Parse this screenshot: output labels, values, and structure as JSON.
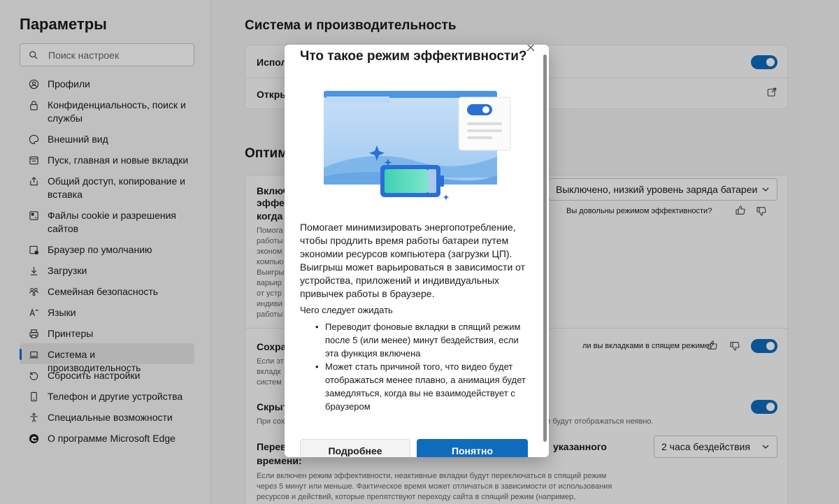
{
  "sidebar": {
    "title": "Параметры",
    "search_placeholder": "Поиск настроек",
    "items": [
      {
        "label": "Профили",
        "icon": "profile-icon"
      },
      {
        "label": "Конфиденциальность, поиск и службы",
        "icon": "lock-icon"
      },
      {
        "label": "Внешний вид",
        "icon": "palette-icon"
      },
      {
        "label": "Пуск, главная и новые вкладки",
        "icon": "home-tab-icon"
      },
      {
        "label": "Общий доступ, копирование и вставка",
        "icon": "share-icon"
      },
      {
        "label": "Файлы cookie и разрешения сайтов",
        "icon": "cookie-icon"
      },
      {
        "label": "Браузер по умолчанию",
        "icon": "default-browser-icon"
      },
      {
        "label": "Загрузки",
        "icon": "download-icon"
      },
      {
        "label": "Семейная безопасность",
        "icon": "family-icon"
      },
      {
        "label": "Языки",
        "icon": "language-icon"
      },
      {
        "label": "Принтеры",
        "icon": "printer-icon"
      },
      {
        "label": "Система и производительность",
        "icon": "laptop-icon",
        "active": true
      },
      {
        "label": "Сбросить настройки",
        "icon": "reset-icon"
      },
      {
        "label": "Телефон и другие устройства",
        "icon": "phone-icon"
      },
      {
        "label": "Специальные возможности",
        "icon": "accessibility-icon"
      },
      {
        "label": "О программе Microsoft Edge",
        "icon": "edge-logo-icon"
      }
    ]
  },
  "main": {
    "section1_title": "Система и производительность",
    "row1_title": "Испол",
    "row2_title": "Откры",
    "section2_title": "Оптим",
    "eff_title_l1": "Включ",
    "eff_title_l2": "эффек",
    "eff_title_l3": "когда",
    "eff_desc": [
      "Помога",
      "работы",
      "эконом",
      "компью",
      "Выигры",
      "варьир",
      "от устр",
      "индиви",
      "работы"
    ],
    "eff_select": "Выключено, низкий уровень заряда батареи",
    "eff_feedback_q": "Вы довольны режимом эффективности?",
    "sleep_title": "Сохра",
    "sleep_desc": [
      "Если эт",
      "вкладк",
      "систем"
    ],
    "sleep_feedback_q": "ли вы вкладками в спящем режиме?",
    "hide_title": "Скрыт",
    "hide_desc_left": "При сох",
    "hide_desc_right": "и будут отображаться неявно.",
    "after_title_l1": "Перев",
    "after_title_right": "указанного",
    "after_title_l2": "времени:",
    "after_select": "2 часа бездействия",
    "after_desc": [
      "Если включен режим эффективности, неактивные вкладки будут переключаться в спящий режим",
      "через 5 минут или меньше. Фактическое время может отличаться в зависимости от использования",
      "ресурсов и действий, которые препятствуют переходу сайта в спящий режим (например,"
    ]
  },
  "dialog": {
    "title": "Что такое режим эффективности?",
    "body": "Помогает минимизировать энергопотребление, чтобы продлить время работы батареи путем экономии ресурсов компьютера (загрузки ЦП). Выигрыш может варьироваться в зависимости от устройства, приложений и индивидуальных привычек работы в браузере.",
    "expect_title": "Чего следует ожидать",
    "bullets": [
      "Переводит фоновые вкладки в спящий режим после 5 (или менее) минут бездействия, если эта функция включена",
      "Может стать причиной того, что видео будет отображаться менее плавно, а анимация будет замедляться, когда вы не взаимодействует с браузером"
    ],
    "btn_secondary": "Подробнее",
    "btn_primary": "Понятно"
  },
  "colors": {
    "accent": "#0f6cbd",
    "overlay": "rgba(0,0,0,0.22)"
  }
}
